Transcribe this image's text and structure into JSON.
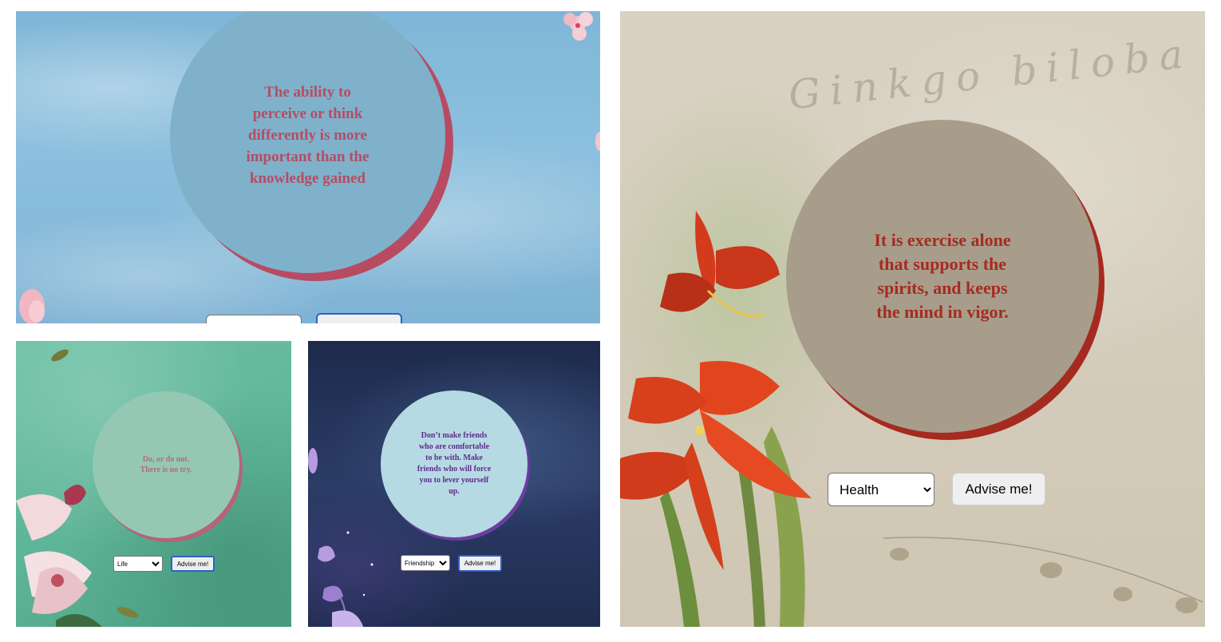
{
  "panels": [
    {
      "id": "blue",
      "quote": "The ability to perceive or think differently is more important than the knowledge gained",
      "colors": {
        "circle": "#7fb1cb",
        "shadow": "#b84b62",
        "text": "#b74c63"
      }
    },
    {
      "id": "green",
      "quote": "Do, or do not. There is no try.",
      "select_value": "Life",
      "button_label": "Advise me!",
      "colors": {
        "circle": "#94c8b3",
        "shadow": "#b5637a",
        "text": "#b76a7c"
      }
    },
    {
      "id": "navy",
      "quote": "Don’t make friends who are comfortable to be with. Make friends who will force you to lever yourself up.",
      "select_value": "Friendship",
      "button_label": "Advise me!",
      "colors": {
        "circle": "#b6dae3",
        "shadow": "#6a3ea0",
        "text": "#5e2a8e"
      }
    },
    {
      "id": "beige",
      "quote": "It is exercise alone that supports the spirits, and keeps the mind in vigor.",
      "select_value": "Health",
      "button_label": "Advise me!",
      "script_watermark": "Ginkgo biloba",
      "colors": {
        "circle": "#a79d8a",
        "shadow": "#a52a1f",
        "text": "#a62b20"
      }
    }
  ]
}
